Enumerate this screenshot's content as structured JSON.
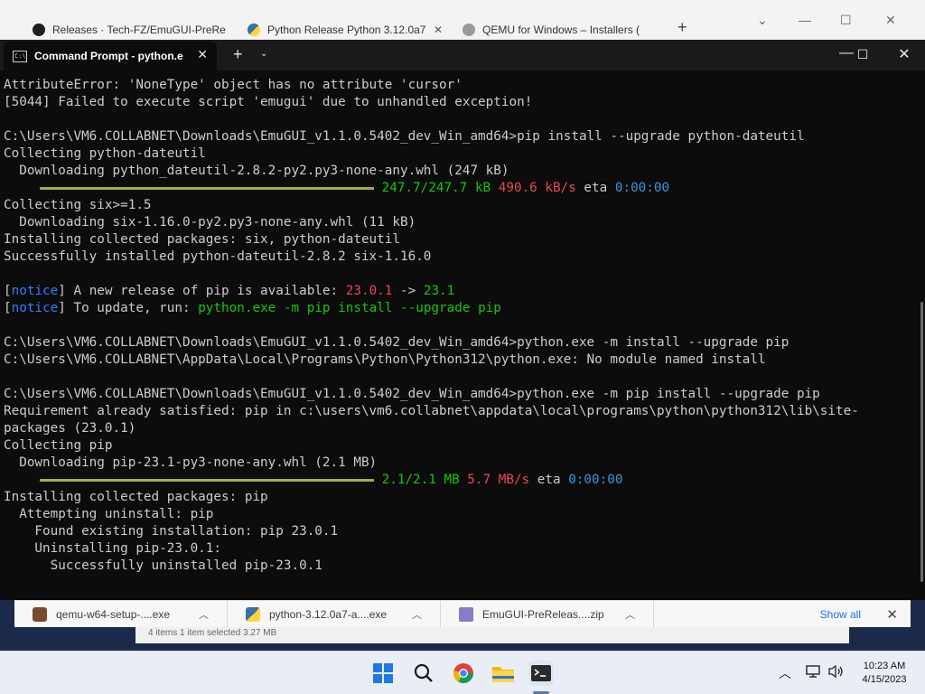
{
  "browser": {
    "tabs": [
      {
        "title": "Releases · Tech-FZ/EmuGUI-PreRe"
      },
      {
        "title": "Python Release Python 3.12.0a7"
      },
      {
        "title": "QEMU for Windows – Installers ("
      }
    ]
  },
  "terminal": {
    "tab_title": "Command Prompt - python.e",
    "lines": [
      [
        {
          "t": "AttributeError: 'NoneType' object has no attribute 'cursor'"
        }
      ],
      [
        {
          "t": "[5044] Failed to execute script 'emugui' due to unhandled exception!"
        }
      ],
      [
        {
          "t": ""
        }
      ],
      [
        {
          "t": "C:\\Users\\VM6.COLLABNET\\Downloads\\EmuGUI_v1.1.0.5402_dev_Win_amd64>pip install --upgrade python-dateutil"
        }
      ],
      [
        {
          "t": "Collecting python-dateutil"
        }
      ],
      [
        {
          "t": "  Downloading python_dateutil-2.8.2-py2.py3-none-any.whl (247 kB)"
        }
      ],
      [
        {
          "bar": 370
        },
        {
          "t": " 247.7/247.7 kB",
          "c": "green"
        },
        {
          "t": " 490.6 kB/s",
          "c": "red"
        },
        {
          "t": " eta "
        },
        {
          "t": "0:00:00",
          "c": "cyan"
        }
      ],
      [
        {
          "t": "Collecting six>=1.5"
        }
      ],
      [
        {
          "t": "  Downloading six-1.16.0-py2.py3-none-any.whl (11 kB)"
        }
      ],
      [
        {
          "t": "Installing collected packages: six, python-dateutil"
        }
      ],
      [
        {
          "t": "Successfully installed python-dateutil-2.8.2 six-1.16.0"
        }
      ],
      [
        {
          "t": ""
        }
      ],
      [
        {
          "t": "["
        },
        {
          "t": "notice",
          "c": "blue"
        },
        {
          "t": "] A new release of pip is available: "
        },
        {
          "t": "23.0.1",
          "c": "red"
        },
        {
          "t": " -> "
        },
        {
          "t": "23.1",
          "c": "green"
        }
      ],
      [
        {
          "t": "["
        },
        {
          "t": "notice",
          "c": "blue"
        },
        {
          "t": "] To update, run: "
        },
        {
          "t": "python.exe -m pip install --upgrade pip",
          "c": "green"
        }
      ],
      [
        {
          "t": ""
        }
      ],
      [
        {
          "t": "C:\\Users\\VM6.COLLABNET\\Downloads\\EmuGUI_v1.1.0.5402_dev_Win_amd64>python.exe -m install --upgrade pip"
        }
      ],
      [
        {
          "t": "C:\\Users\\VM6.COLLABNET\\AppData\\Local\\Programs\\Python\\Python312\\python.exe: No module named install"
        }
      ],
      [
        {
          "t": ""
        }
      ],
      [
        {
          "t": "C:\\Users\\VM6.COLLABNET\\Downloads\\EmuGUI_v1.1.0.5402_dev_Win_amd64>python.exe -m pip install --upgrade pip"
        }
      ],
      [
        {
          "t": "Requirement already satisfied: pip in c:\\users\\vm6.collabnet\\appdata\\local\\programs\\python\\python312\\lib\\site-"
        }
      ],
      [
        {
          "t": "packages (23.0.1)"
        }
      ],
      [
        {
          "t": "Collecting pip"
        }
      ],
      [
        {
          "t": "  Downloading pip-23.1-py3-none-any.whl (2.1 MB)"
        }
      ],
      [
        {
          "bar": 370
        },
        {
          "t": " 2.1/2.1 MB",
          "c": "green"
        },
        {
          "t": " 5.7 MB/s",
          "c": "red"
        },
        {
          "t": " eta "
        },
        {
          "t": "0:00:00",
          "c": "cyan"
        }
      ],
      [
        {
          "t": "Installing collected packages: pip"
        }
      ],
      [
        {
          "t": "  Attempting uninstall: pip"
        }
      ],
      [
        {
          "t": "    Found existing installation: pip 23.0.1"
        }
      ],
      [
        {
          "t": "    Uninstalling pip-23.0.1:"
        }
      ],
      [
        {
          "t": "      Successfully uninstalled pip-23.0.1"
        }
      ]
    ]
  },
  "downloads": {
    "items": [
      {
        "name": "qemu-w64-setup-....exe"
      },
      {
        "name": "python-3.12.0a7-a....exe"
      },
      {
        "name": "EmuGUI-PreReleas....zip"
      }
    ],
    "show_all": "Show all"
  },
  "explorer": {
    "status": "4 items     1 item selected  3.27 MB"
  },
  "taskbar": {
    "time": "10:23 AM",
    "date": "4/15/2023"
  }
}
